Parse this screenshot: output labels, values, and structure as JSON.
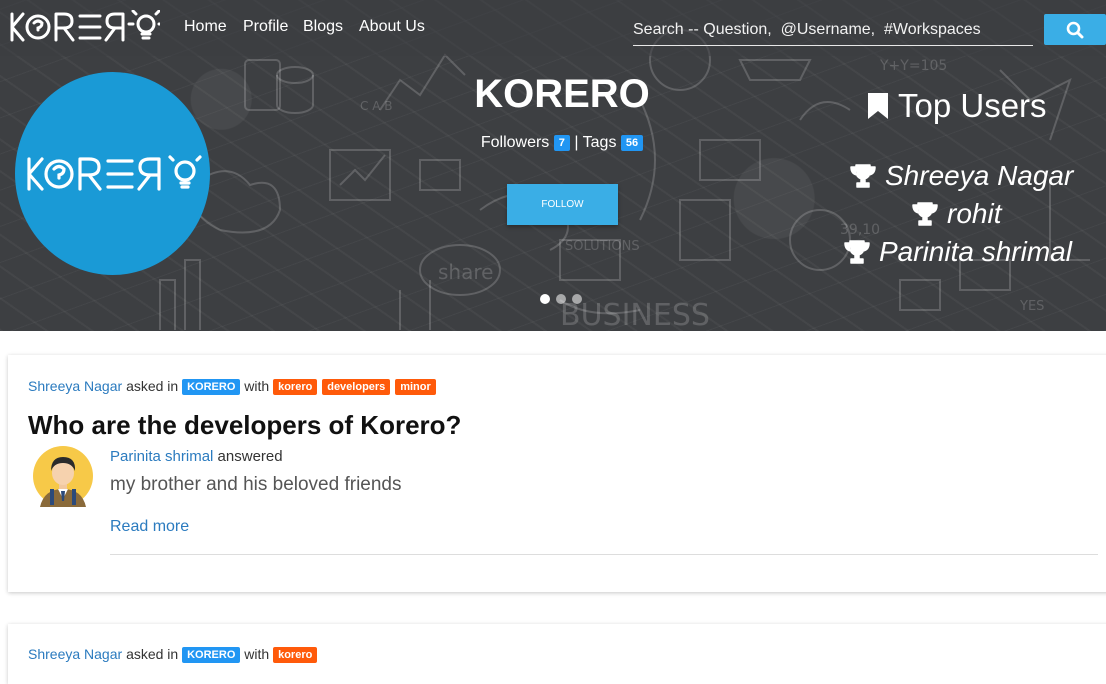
{
  "nav": {
    "brand": "KORERO",
    "links": [
      "Home",
      "Profile",
      "Blogs",
      "About Us"
    ],
    "search_placeholder": "Search -- Question,  @Username,  #Workspaces"
  },
  "hero": {
    "logo_text": "KORERO",
    "title": "KORERO",
    "followers_label": "Followers",
    "followers_count": "7",
    "separator": "|",
    "tags_label": "Tags",
    "tags_count": "56",
    "follow_button": "FOLLOW",
    "carousel": {
      "slides": 3,
      "active": 1
    },
    "top_users": {
      "title": "Top Users",
      "users": [
        "Shreeya Nagar",
        "rohit",
        "Parinita shrimal"
      ]
    }
  },
  "posts": [
    {
      "author": "Shreeya Nagar",
      "asked_in_text": "asked in",
      "workspace": "KORERO",
      "with_text": "with",
      "tags": [
        "korero",
        "developers",
        "minor"
      ],
      "question": "Who are the developers of Korero?",
      "answerer": "Parinita shrimal",
      "answered_text": "answered",
      "answer": "my brother and his beloved friends",
      "read_more": "Read more"
    },
    {
      "author": "Shreeya Nagar",
      "asked_in_text": "asked in",
      "workspace": "KORERO",
      "with_text": "with",
      "tags": [
        "korero"
      ]
    }
  ],
  "colors": {
    "accent": "#3aaee6",
    "badge_blue": "#2196f3",
    "tag_orange": "#ff5a0a",
    "link": "#2b7bbf",
    "hero_bg": "#3d3f42"
  },
  "icons": {
    "search": "search-icon",
    "top_users": "bookmark-icon",
    "user_rank": "trophy-icon"
  }
}
